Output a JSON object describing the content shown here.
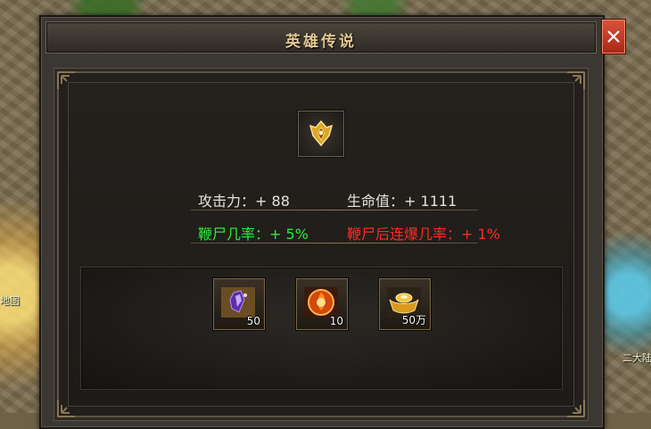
{
  "world": {
    "map_label_left": "地图",
    "map_label_right": "二大陆"
  },
  "dialog": {
    "title": "英雄传说",
    "close_icon": "close-icon",
    "hero_icon": "golden-helmet-icon"
  },
  "stats": {
    "attack_label": "攻击力：",
    "attack_value": "+ 88",
    "hp_label": "生命值：",
    "hp_value": "+ 1111",
    "whip_label": "鞭尸几率：",
    "whip_value": "+ 5%",
    "combo_label": "鞭尸后连爆几率：",
    "combo_value": "+ 1%"
  },
  "rewards": [
    {
      "icon": "purple-crystal-icon",
      "count": "50"
    },
    {
      "icon": "fire-orb-icon",
      "count": "10"
    },
    {
      "icon": "gold-ingot-icon",
      "count": "50万"
    }
  ],
  "colors": {
    "title": "#e3c891",
    "positive": "#2ee83a",
    "special": "#ff2a1e",
    "close_button": "#c13a25"
  }
}
